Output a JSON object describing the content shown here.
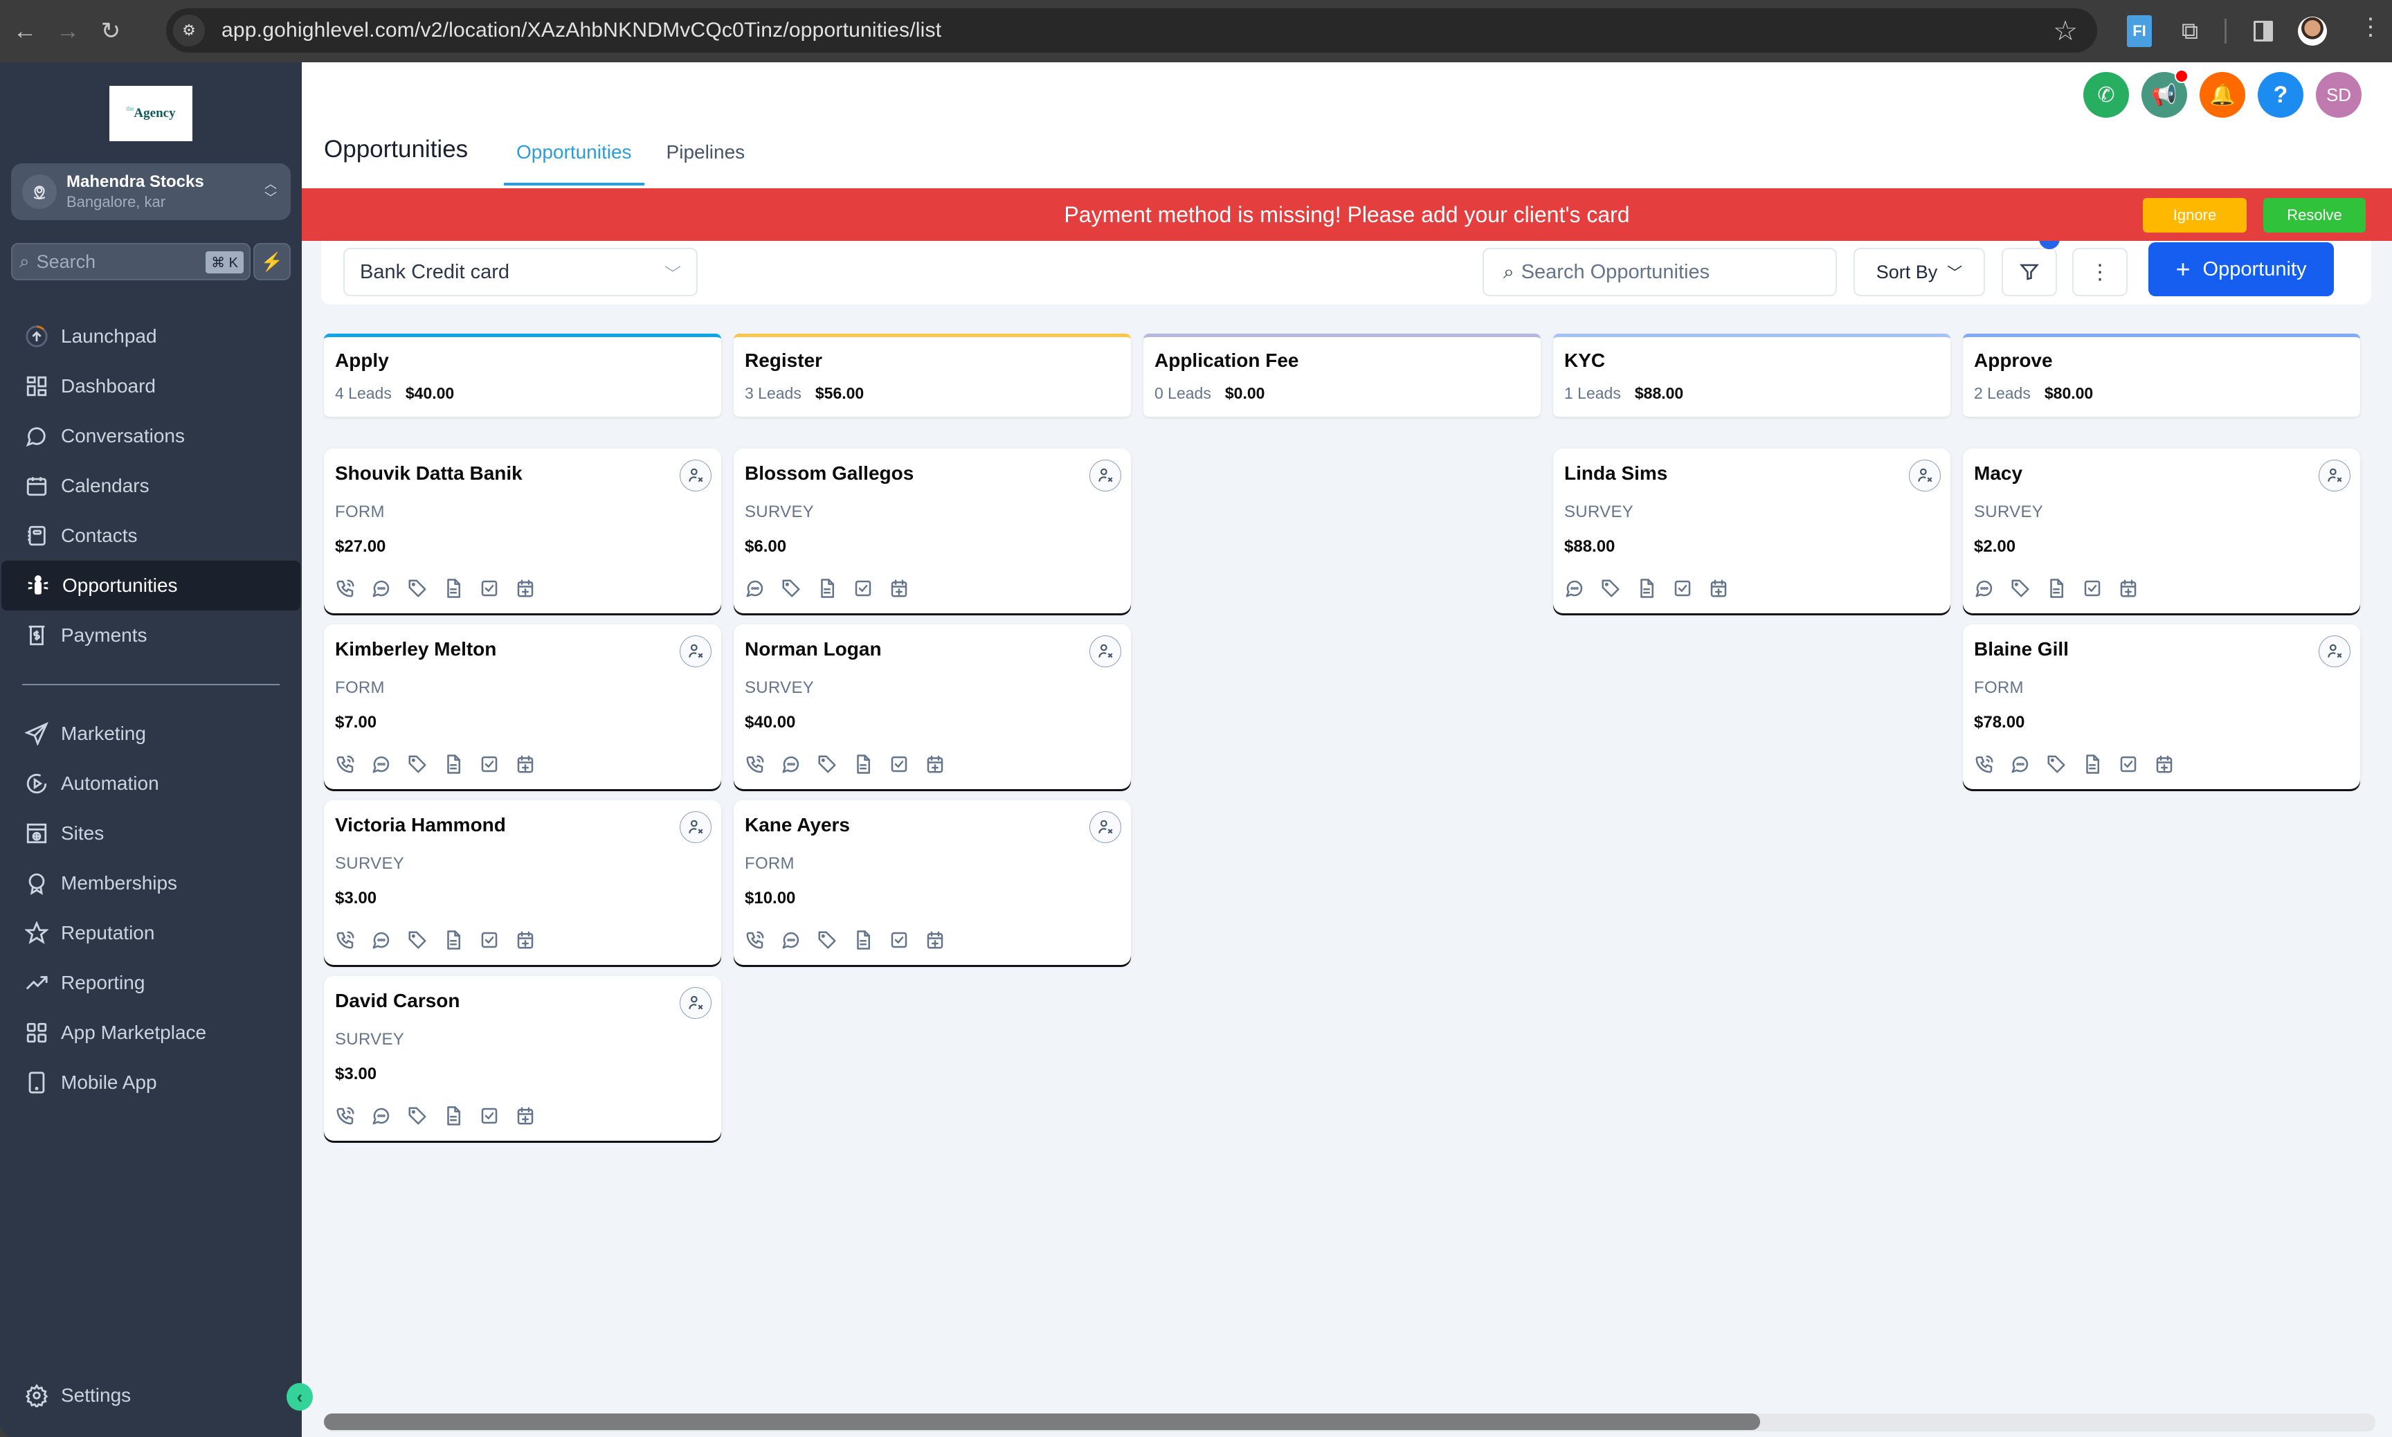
{
  "browser": {
    "url": "app.gohighlevel.com/v2/location/XAzAhbNKNDMvCQc0Tinz/opportunities/list",
    "back_icon": "arrow-left-icon",
    "forward_icon": "arrow-right-icon",
    "reload_icon": "reload-icon",
    "extension_label": "FI"
  },
  "sidebar": {
    "logo_small": "the",
    "logo_text": "Agency",
    "location": {
      "name": "Mahendra Stocks",
      "subtitle": "Bangalore, kar"
    },
    "search": {
      "placeholder": "Search",
      "shortcut": "⌘ K"
    },
    "items": [
      {
        "label": "Launchpad",
        "icon": "launchpad-icon"
      },
      {
        "label": "Dashboard",
        "icon": "dashboard-icon"
      },
      {
        "label": "Conversations",
        "icon": "chat-bubble-icon"
      },
      {
        "label": "Calendars",
        "icon": "calendar-icon"
      },
      {
        "label": "Contacts",
        "icon": "contacts-book-icon"
      },
      {
        "label": "Opportunities",
        "icon": "opportunities-icon",
        "active": true
      },
      {
        "label": "Payments",
        "icon": "payments-icon"
      }
    ],
    "items_secondary": [
      {
        "label": "Marketing",
        "icon": "paper-plane-icon"
      },
      {
        "label": "Automation",
        "icon": "automation-icon"
      },
      {
        "label": "Sites",
        "icon": "sites-globe-icon"
      },
      {
        "label": "Memberships",
        "icon": "award-badge-icon"
      },
      {
        "label": "Reputation",
        "icon": "star-icon"
      },
      {
        "label": "Reporting",
        "icon": "trending-up-icon"
      },
      {
        "label": "App Marketplace",
        "icon": "grid-icon"
      },
      {
        "label": "Mobile App",
        "icon": "mobile-icon"
      }
    ],
    "settings_label": "Settings"
  },
  "header": {
    "page_title": "Opportunities",
    "tabs": [
      {
        "label": "Opportunities",
        "active": true
      },
      {
        "label": "Pipelines",
        "active": false
      }
    ],
    "user_initials": "SD",
    "help_label": "?"
  },
  "banner": {
    "message": "Payment method is missing! Please add your client's card",
    "ignore_label": "Ignore",
    "resolve_label": "Resolve",
    "color": "#e53e3e"
  },
  "toolbar": {
    "pipeline_selected": "Bank Credit card",
    "search_placeholder": "Search Opportunities",
    "sort_label": "Sort By",
    "add_label": "Opportunity"
  },
  "stages": [
    {
      "name": "Apply",
      "leads": "4 Leads",
      "amount": "$40.00",
      "color": "#0ea5e9",
      "cards": [
        {
          "name": "Shouvik Datta Banik",
          "source": "FORM",
          "value": "$27.00",
          "phone": true
        },
        {
          "name": "Kimberley Melton",
          "source": "FORM",
          "value": "$7.00",
          "phone": true
        },
        {
          "name": "Victoria Hammond",
          "source": "SURVEY",
          "value": "$3.00",
          "phone": true
        },
        {
          "name": "David Carson",
          "source": "SURVEY",
          "value": "$3.00",
          "phone": true
        }
      ]
    },
    {
      "name": "Register",
      "leads": "3 Leads",
      "amount": "$56.00",
      "color": "#fcc64d",
      "cards": [
        {
          "name": "Blossom Gallegos",
          "source": "SURVEY",
          "value": "$6.00",
          "phone": false
        },
        {
          "name": "Norman Logan",
          "source": "SURVEY",
          "value": "$40.00",
          "phone": true
        },
        {
          "name": "Kane Ayers",
          "source": "FORM",
          "value": "$10.00",
          "phone": true
        }
      ]
    },
    {
      "name": "Application Fee",
      "leads": "0 Leads",
      "amount": "$0.00",
      "color": "#b4b8dc",
      "cards": []
    },
    {
      "name": "KYC",
      "leads": "1 Leads",
      "amount": "$88.00",
      "color": "#a5c0fa",
      "cards": [
        {
          "name": "Linda Sims",
          "source": "SURVEY",
          "value": "$88.00",
          "phone": false
        }
      ]
    },
    {
      "name": "Approve",
      "leads": "2 Leads",
      "amount": "$80.00",
      "color": "#80aaf7",
      "cards": [
        {
          "name": "Macy",
          "source": "SURVEY",
          "value": "$2.00",
          "phone": false
        },
        {
          "name": "Blaine Gill",
          "source": "FORM",
          "value": "$78.00",
          "phone": true
        }
      ]
    }
  ],
  "scrollbar": {
    "thumb_fraction": 0.7
  }
}
